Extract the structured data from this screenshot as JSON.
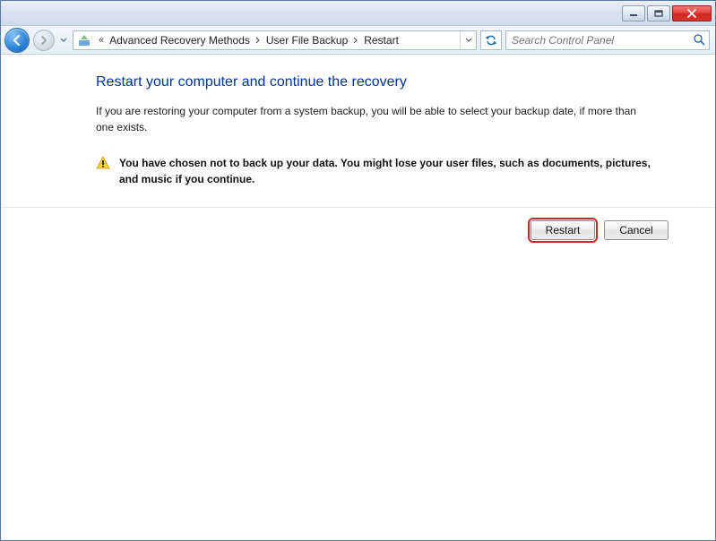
{
  "breadcrumb": {
    "items": [
      "Advanced Recovery Methods",
      "User File Backup",
      "Restart"
    ]
  },
  "search": {
    "placeholder": "Search Control Panel"
  },
  "page": {
    "title": "Restart your computer and continue the recovery",
    "description": "If you are restoring your computer from a system backup, you will be able to select your backup date, if more than one exists."
  },
  "warning": {
    "text": "You have chosen not to back up your data. You might lose your user files, such as documents, pictures, and music if you continue."
  },
  "buttons": {
    "restart": "Restart",
    "cancel": "Cancel"
  }
}
